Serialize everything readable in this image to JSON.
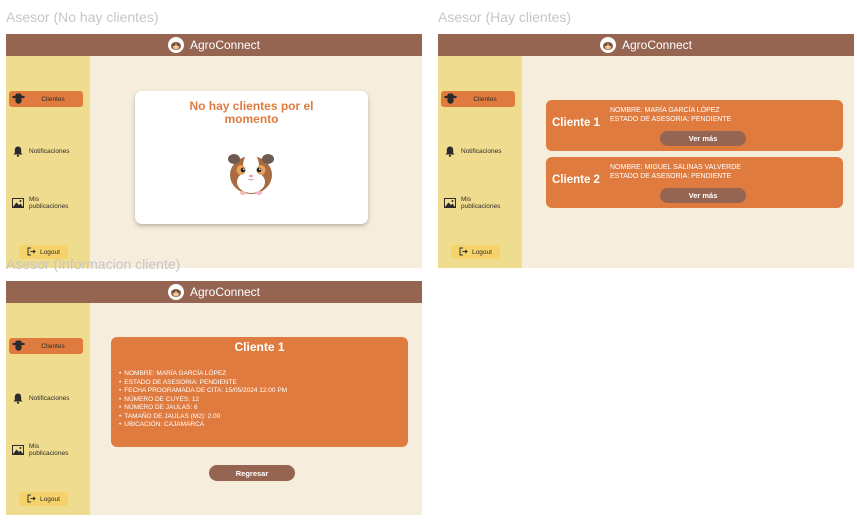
{
  "app_title": "AgroConnect",
  "frames": {
    "no_clients": "Asesor (No hay clientes)",
    "has_clients": "Asesor (Hay clientes)",
    "client_info": "Asesor (Informacion cliente)"
  },
  "nav": {
    "clients": "Clientes",
    "notifications": "Notificaciones",
    "publications": "Mis publicaciones",
    "logout": "Logout"
  },
  "empty_state": {
    "line1": "No hay clientes por el",
    "line2": "momento"
  },
  "clients": [
    {
      "title": "Cliente 1",
      "name_line": "NOMBRE: MARÍA GARCÍA LÓPEZ",
      "status_line": "ESTADO DE ASESORIA: PENDIENTE",
      "button": "Ver más"
    },
    {
      "title": "Cliente 2",
      "name_line": "NOMBRE: MIGUEL SALINAS VALVERDE",
      "status_line": "ESTADO DE ASESORIA: PENDIENTE",
      "button": "Ver más"
    }
  ],
  "detail": {
    "title": "Cliente 1",
    "items": [
      "NOMBRE: MARÍA GARCÍA LÓPEZ",
      "ESTADO DE ASESORIA: PENDIENTE",
      "FECHA PROGRAMADA DE CITA: 15/05/2024 12:00 PM",
      "NÚMERO DE CUYES: 12",
      "NÚMERO DE JAULAS: 6",
      "TAMAÑO DE JAULAS (M2): 2.00",
      "UBICACIÓN: CAJAMARCA"
    ],
    "back_button": "Regresar"
  },
  "colors": {
    "header": "#956552",
    "sidebar": "#f0dc8e",
    "content_bg": "#f6eddc",
    "accent": "#e07b3f",
    "logout": "#f5d36a"
  },
  "icons": [
    "farmer-icon",
    "bell-icon",
    "image-icon",
    "logout-icon",
    "guinea-pig-logo",
    "guinea-pig-illustration"
  ]
}
